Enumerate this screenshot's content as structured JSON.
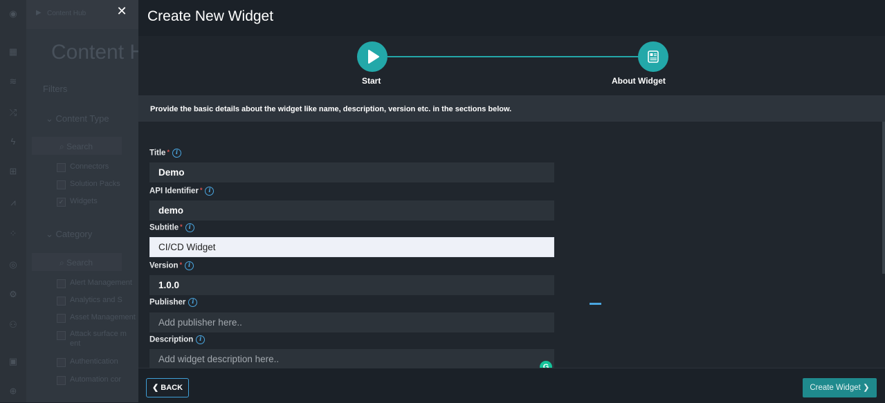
{
  "background_app": {
    "breadcrumb": "Content Hub",
    "page_heading": "Content Hub",
    "filters_label": "Filters",
    "content_type_heading": "Content Type",
    "search_placeholder": "Search",
    "content_types": [
      {
        "label": "Connectors",
        "checked": false
      },
      {
        "label": "Solution Packs",
        "checked": false
      },
      {
        "label": "Widgets",
        "checked": true
      }
    ],
    "category_heading": "Category",
    "categories": [
      "Alert Management",
      "Analytics and S",
      "Asset Management",
      "Attack surface m",
      "ent",
      "Authentication",
      "Automation cor"
    ],
    "rail_icons": [
      "logo-icon",
      "dashboard-icon",
      "queue-icon",
      "shuffle-icon",
      "bolt-icon",
      "briefcase-icon",
      "chart-icon",
      "apps-icon",
      "content-hub-icon",
      "settings-icon",
      "users-icon",
      "trash-icon",
      "globe-icon"
    ]
  },
  "modal": {
    "title": "Create New Widget",
    "close_glyph": "✕",
    "steps": [
      {
        "label": "Start",
        "icon": "play-icon",
        "active": true
      },
      {
        "label": "About Widget",
        "icon": "widget-form-icon",
        "active": true
      }
    ],
    "info_text": "Provide the basic details about the widget like name, description, version etc. in the sections below.",
    "fields": {
      "title": {
        "label": "Title",
        "required": true,
        "value": "Demo",
        "placeholder": ""
      },
      "api_identifier": {
        "label": "API Identifier",
        "required": true,
        "value": "demo",
        "placeholder": ""
      },
      "subtitle": {
        "label": "Subtitle",
        "required": true,
        "value": "CI/CD Widget",
        "placeholder": ""
      },
      "version": {
        "label": "Version",
        "required": true,
        "value": "1.0.0",
        "placeholder": ""
      },
      "publisher": {
        "label": "Publisher",
        "required": false,
        "value": "",
        "placeholder": "Add publisher here.."
      },
      "description": {
        "label": "Description",
        "required": false,
        "value": "",
        "placeholder": "Add widget description here.."
      }
    },
    "required_mark": "*",
    "info_glyph": "i",
    "grammarly_glyph": "G",
    "back_label": "BACK",
    "back_glyph": "❮",
    "create_label": "Create Widget",
    "create_glyph": "❯"
  },
  "colors": {
    "accent": "#23a8a9",
    "modal_bg": "#20262d",
    "info_bar": "#2d343c",
    "required": "#d9534f",
    "info_icon": "#4aa6e0"
  }
}
